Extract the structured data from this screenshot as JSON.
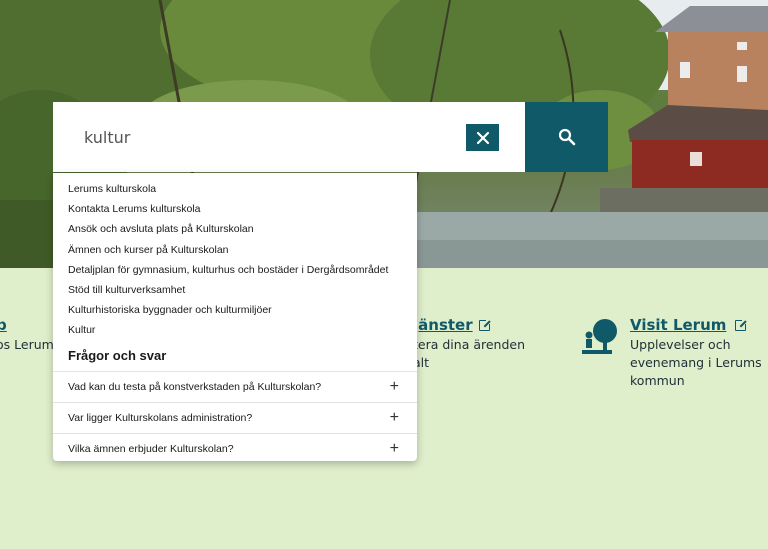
{
  "search": {
    "value": "kultur",
    "placeholder": ""
  },
  "suggestions": [
    "Lerums kulturskola",
    "Kontakta Lerums kulturskola",
    "Ansök och avsluta plats på Kulturskolan",
    "Ämnen och kurser på Kulturskolan",
    "Detaljplan för gymnasium, kulturhus och bostäder i Dergårdsområdet",
    "Stöd till kulturverksamhet",
    "Kulturhistoriska byggnader och kulturmiljöer",
    "Kultur"
  ],
  "faq": {
    "heading": "Frågor och svar",
    "items": [
      "Vad kan du testa på konstverkstaden på Kulturskolan?",
      "Var ligger Kulturskolans administration?",
      "Vilka ämnen erbjuder Kulturskolan?"
    ]
  },
  "quick_links": {
    "left": {
      "title": "b",
      "desc": "os Lerum"
    },
    "middle": {
      "title": "jänster",
      "line1": "tera dina ärenden",
      "line2": "alt"
    },
    "right": {
      "title": "Visit Lerum",
      "line1": "Upplevelser och",
      "line2": "evenemang i Lerums",
      "line3": "kommun"
    }
  },
  "icons": {
    "clear": "close-icon",
    "search": "search-icon",
    "visit": "tree-person-icon",
    "external": "external-link-icon"
  },
  "colors": {
    "accent": "#0f5968",
    "band": "#dfeecb"
  }
}
